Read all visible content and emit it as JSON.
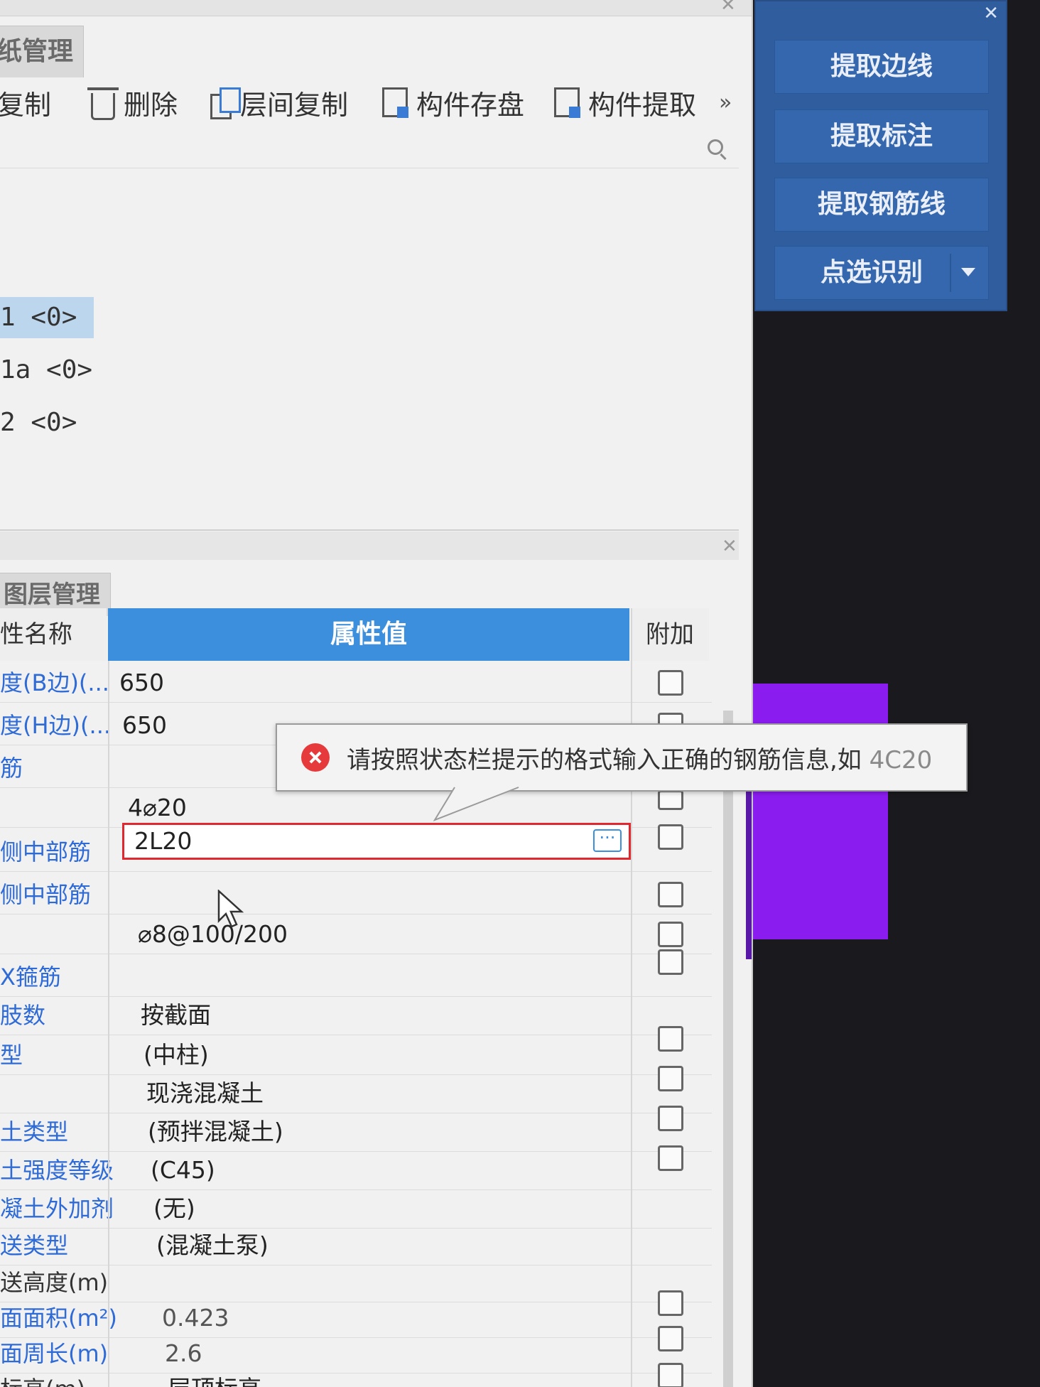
{
  "top_tab": "纸管理",
  "toolbar": {
    "copy": "复制",
    "delete": "删除",
    "floor_copy": "层间复制",
    "save_component": "构件存盘",
    "extract_component": "构件提取",
    "more": "»"
  },
  "tree": [
    "1 <0>",
    "1a <0>",
    "2 <0>"
  ],
  "layer_tab": "图层管理",
  "columns": {
    "name": "性名称",
    "value": "属性值",
    "extra": "附加"
  },
  "rows": [
    {
      "name": "度(B边)(...",
      "value": "650"
    },
    {
      "name": "度(H边)(...",
      "value": "650"
    },
    {
      "name": "筋",
      "value": ""
    },
    {
      "name": "",
      "value": "4⌀20"
    },
    {
      "name": "侧中部筋",
      "value": "2L20"
    },
    {
      "name": "侧中部筋",
      "value": ""
    },
    {
      "name": "",
      "value": "⌀8@100/200"
    },
    {
      "name": "X箍筋",
      "value": ""
    },
    {
      "name": "肢数",
      "value": "按截面"
    },
    {
      "name": "型",
      "value": "(中柱)"
    },
    {
      "name": "",
      "value": "现浇混凝土"
    },
    {
      "name": "土类型",
      "value": "(预拌混凝土)"
    },
    {
      "name": "土强度等级",
      "value": "(C45)"
    },
    {
      "name": "凝土外加剂",
      "value": "(无)"
    },
    {
      "name": "送类型",
      "value": "(混凝土泵)"
    },
    {
      "name": "送高度(m)",
      "value": ""
    },
    {
      "name": "面面积(m²)",
      "value": "0.423"
    },
    {
      "name": "面周长(m)",
      "value": "2.6"
    },
    {
      "name": "标高(m)",
      "value": "层顶标高"
    }
  ],
  "tooltip": {
    "message": "请按照状态栏提示的格式输入正确的钢筋信息,如 ",
    "example": "4C20"
  },
  "right_panel": {
    "buttons": [
      "提取边线",
      "提取标注",
      "提取钢筋线",
      "点选识别"
    ]
  },
  "colors": {
    "header_blue": "#3b8fdc",
    "error_red": "#e0282e",
    "panel_blue": "#2f5d9e",
    "purple": "#8a1cf0"
  }
}
